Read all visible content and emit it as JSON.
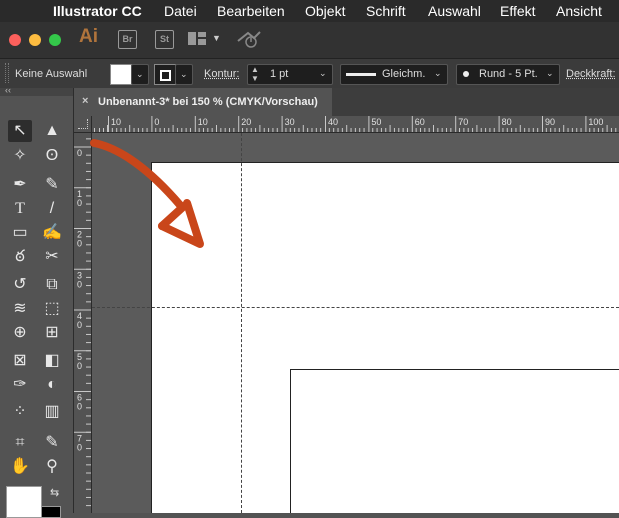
{
  "menubar": {
    "items": [
      "Illustrator CC",
      "Datei",
      "Bearbeiten",
      "Objekt",
      "Schrift",
      "Auswahl",
      "Effekt",
      "Ansicht"
    ]
  },
  "appbar": {
    "logo": "Ai",
    "bridge": "Br",
    "stock": "St"
  },
  "controlbar": {
    "selection_status": "Keine Auswahl",
    "stroke_label": "Kontur:",
    "stroke_weight": "1 pt",
    "profile": "Gleichm.",
    "brush": "Rund - 5 Pt.",
    "opacity_label": "Deckkraft:"
  },
  "document": {
    "tab_title": "Unbenannt-3* bei 150 % (CMYK/Vorschau)",
    "close_glyph": "×"
  },
  "rulers": {
    "horizontal": [
      "10",
      "0",
      "10",
      "20",
      "30",
      "40",
      "50",
      "60",
      "70",
      "80",
      "90",
      "100"
    ],
    "vertical": [
      "0",
      "1\n0",
      "2\n0",
      "3\n0",
      "4\n0",
      "5\n0",
      "6\n0",
      "7\n0"
    ]
  },
  "colors": {
    "annotation_arrow": "#c9461a"
  }
}
